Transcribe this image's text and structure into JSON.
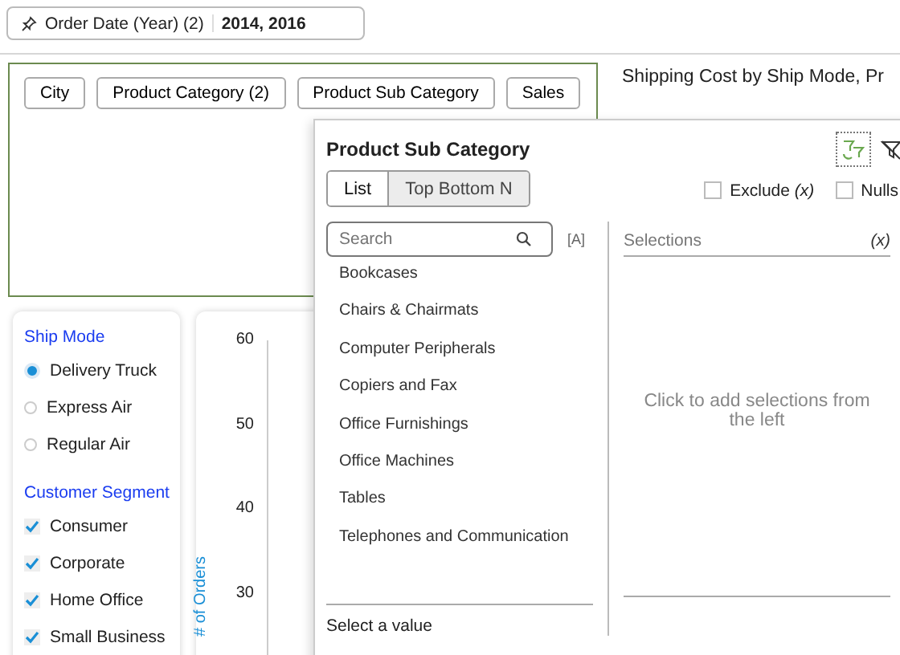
{
  "top_filter": {
    "label": "Order Date (Year) (2)",
    "value": "2014, 2016"
  },
  "canvas_chips": [
    "City",
    "Product Category (2)",
    "Product Sub Category",
    "Sales"
  ],
  "viz_title": "Shipping Cost by Ship Mode, Pr",
  "ship_mode": {
    "title": "Ship Mode",
    "options": [
      {
        "label": "Delivery Truck",
        "selected": true
      },
      {
        "label": "Express Air",
        "selected": false
      },
      {
        "label": "Regular Air",
        "selected": false
      }
    ]
  },
  "customer_segment": {
    "title": "Customer Segment",
    "options": [
      {
        "label": "Consumer",
        "checked": true
      },
      {
        "label": "Corporate",
        "checked": true
      },
      {
        "label": "Home Office",
        "checked": true
      },
      {
        "label": "Small Business",
        "checked": true
      }
    ]
  },
  "chart": {
    "y_ticks": [
      "60",
      "50",
      "40",
      "30"
    ],
    "ylabel": "# of Orders"
  },
  "popup": {
    "title": "Product Sub Category",
    "tabs": [
      {
        "label": "List",
        "selected": true
      },
      {
        "label": "Top Bottom N",
        "selected": false
      }
    ],
    "exclude": {
      "label": "Exclude",
      "mark": "(x)",
      "checked": false
    },
    "nulls": {
      "label": "Nulls",
      "checked": false
    },
    "search": {
      "placeholder": "Search"
    },
    "case_toggle": "[A]",
    "items": [
      "Bookcases",
      "Chairs & Chairmats",
      "Computer Peripherals",
      "Copiers and Fax",
      "Office Furnishings",
      "Office Machines",
      "Tables",
      "Telephones and Communication"
    ],
    "footer": "Select a value",
    "selections": {
      "title": "Selections",
      "mark": "(x)",
      "empty": "Click to add selections from the left"
    }
  }
}
